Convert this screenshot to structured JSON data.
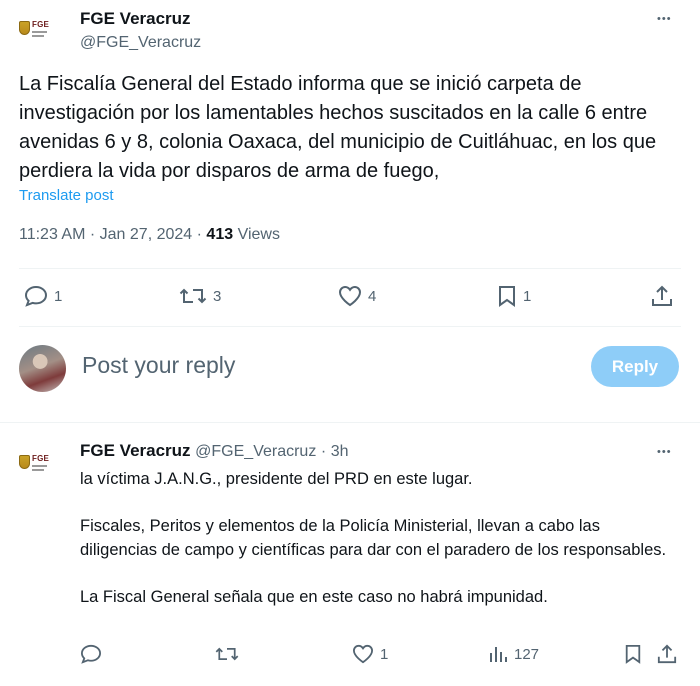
{
  "tweet": {
    "author_name": "FGE Veracruz",
    "author_handle": "@FGE_Veracruz",
    "logo_text": "FGE",
    "more_label": "•••",
    "text": "La Fiscalía General del Estado informa que se inició carpeta de investigación por los lamentables hechos suscitados en la calle 6 entre avenidas 6 y 8, colonia Oaxaca, del municipio de Cuitláhuac, en los que perdiera la vida por disparos de arma de fuego,",
    "translate_label": "Translate post",
    "time": "11:23 AM",
    "date": "Jan 27, 2024",
    "views_count": "413",
    "views_label": "Views",
    "actions": {
      "replies": "1",
      "reposts": "3",
      "likes": "4",
      "bookmarks": "1"
    }
  },
  "composer": {
    "placeholder": "Post your reply",
    "reply_button": "Reply"
  },
  "reply": {
    "author_name": "FGE Veracruz",
    "author_handle": "@FGE_Veracruz",
    "time_ago": "· 3h",
    "logo_text": "FGE",
    "more_label": "•••",
    "paragraphs": [
      "la víctima J.A.N.G., presidente del PRD en este lugar.",
      "Fiscales, Peritos y elementos de la Policía Ministerial, llevan a cabo las diligencias de campo y científicas para dar con el paradero de los responsables.",
      "La Fiscal General señala que en este caso no habrá impunidad."
    ],
    "actions": {
      "likes": "1",
      "views": "127"
    }
  },
  "colors": {
    "accent": "#1d9bf0",
    "reply_button_disabled": "#8ecdf8",
    "secondary_text": "#536471"
  }
}
